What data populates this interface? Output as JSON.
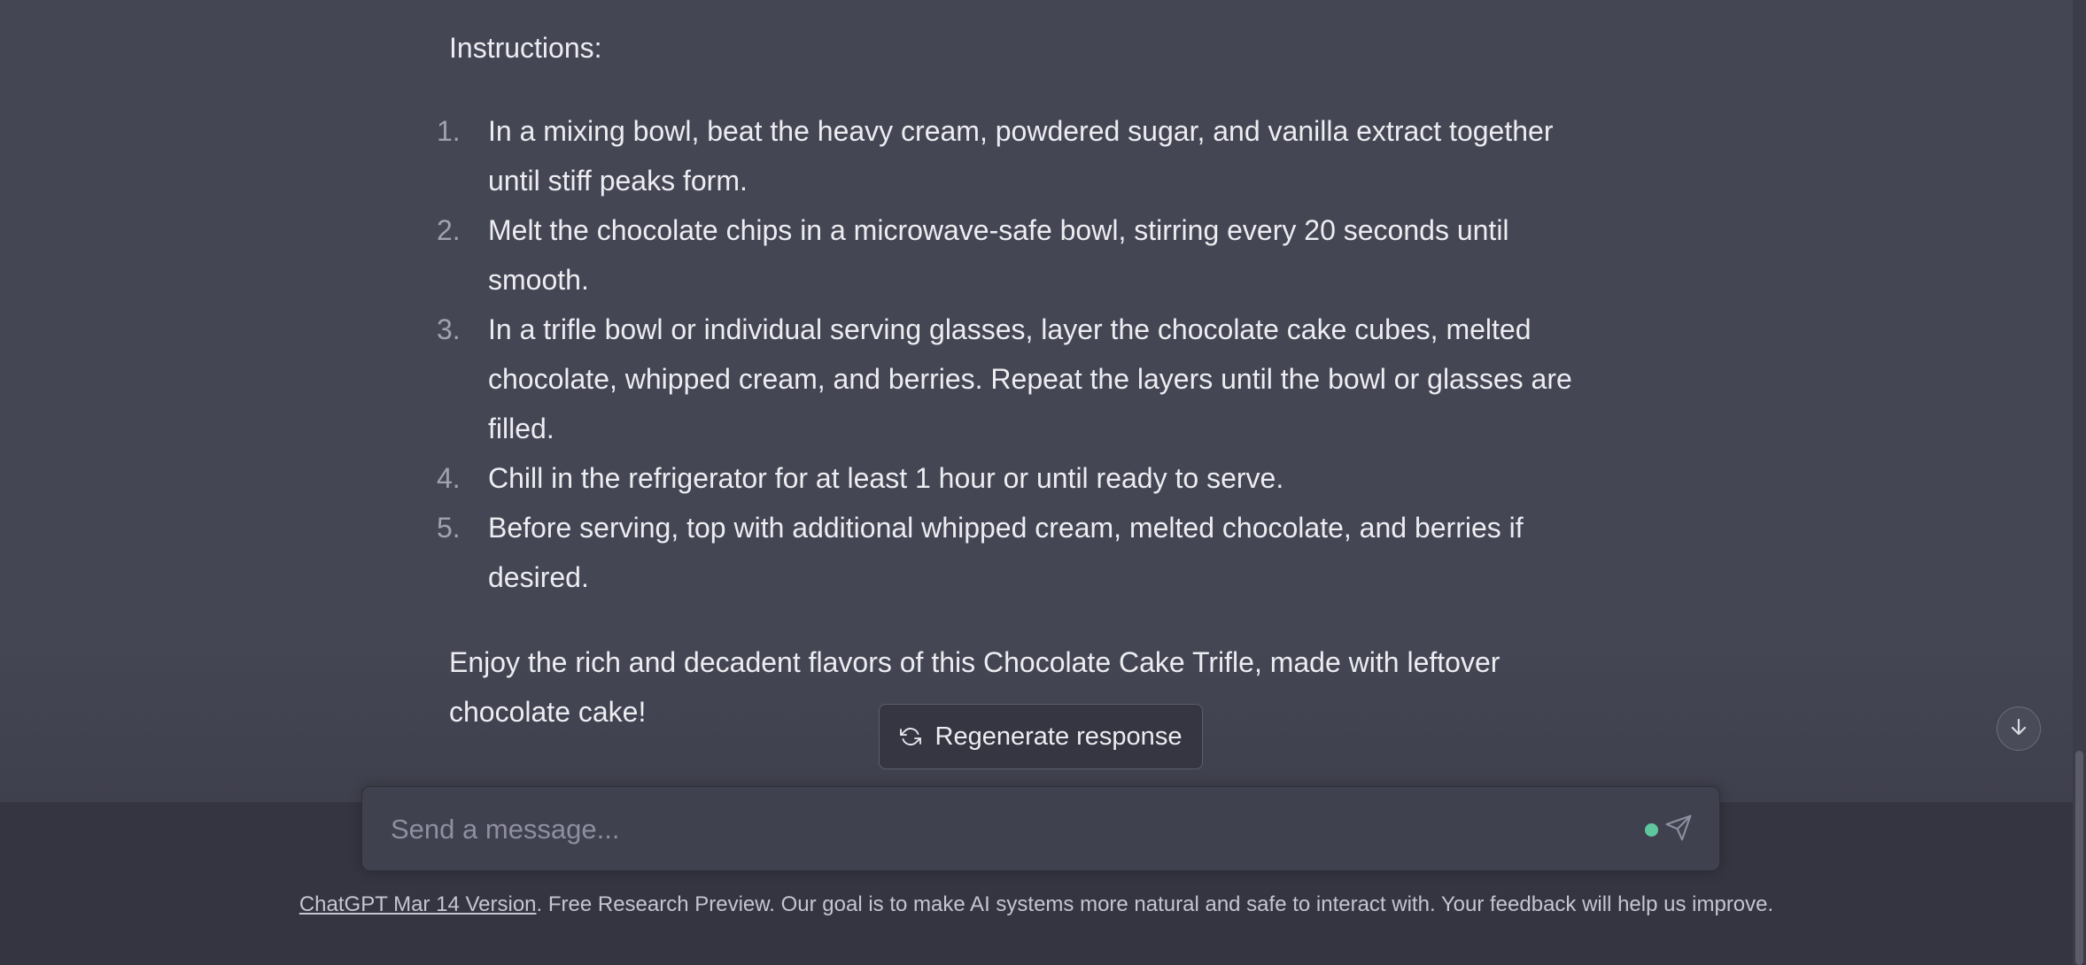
{
  "message": {
    "heading": "Instructions:",
    "steps": [
      {
        "num": "1.",
        "lines": [
          "In a mixing bowl, beat the heavy cream, powdered sugar, and vanilla extract together",
          "until stiff peaks form."
        ]
      },
      {
        "num": "2.",
        "lines": [
          "Melt the chocolate chips in a microwave-safe bowl, stirring every 20 seconds until",
          "smooth."
        ]
      },
      {
        "num": "3.",
        "lines": [
          "In a trifle bowl or individual serving glasses, layer the chocolate cake cubes, melted",
          "chocolate, whipped cream, and berries. Repeat the layers until the bowl or glasses are",
          "filled."
        ]
      },
      {
        "num": "4.",
        "lines": [
          "Chill in the refrigerator for at least 1 hour or until ready to serve."
        ]
      },
      {
        "num": "5.",
        "lines": [
          "Before serving, top with additional whipped cream, melted chocolate, and berries if",
          "desired."
        ]
      }
    ],
    "closing_lines": [
      "Enjoy the rich and decadent flavors of this Chocolate Cake Trifle, made with leftover",
      "chocolate cake!"
    ]
  },
  "regenerate": {
    "label": "Regenerate response",
    "icon": "refresh-icon"
  },
  "scroll_down": {
    "icon": "arrow-down-icon"
  },
  "composer": {
    "placeholder": "Send a message...",
    "value": "",
    "status_color": "#5fc79e",
    "send_icon": "send-icon"
  },
  "footer": {
    "link_text": "ChatGPT Mar 14 Version",
    "text": ". Free Research Preview. Our goal is to make AI systems more natural and safe to interact with. Your feedback will help us improve."
  },
  "colors": {
    "chat_background": "#444654",
    "bottom_background": "#343541",
    "input_background": "#40414f",
    "text": "#ececf1",
    "muted_text": "#8e8ea0"
  }
}
